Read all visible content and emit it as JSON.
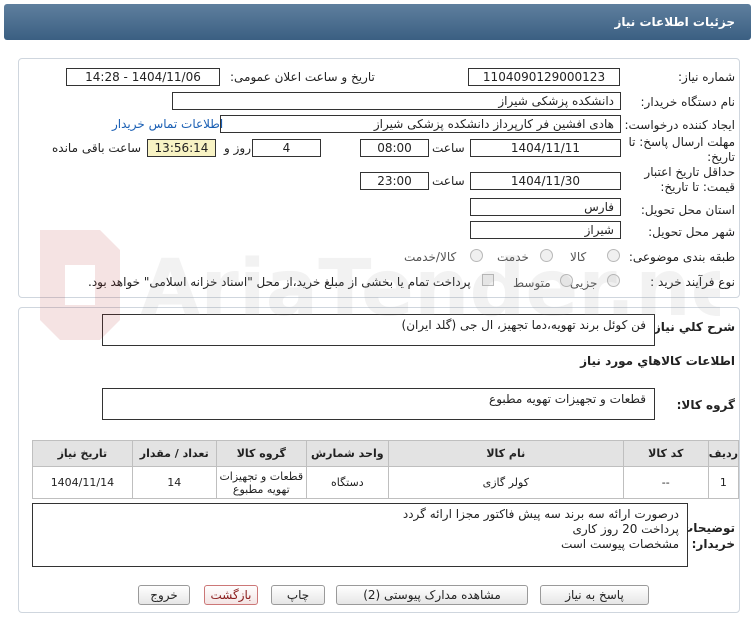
{
  "header": {
    "title": "جزئیات اطلاعات نیاز"
  },
  "form": {
    "need_number_label": "شماره نیاز:",
    "need_number": "1104090129000123",
    "announce_label": "تاریخ و ساعت اعلان عمومی:",
    "announce_value": "1404/11/06 - 14:28",
    "buyer_label": "نام دستگاه خریدار:",
    "buyer_value": "دانشکده پزشکی شیراز",
    "creator_label": "ایجاد کننده درخواست:",
    "creator_value": "هادی افشین فر کارپرداز دانشکده پزشکی شیراز",
    "contact_link": "اطلاعات تماس خریدار",
    "reply_deadline_label": "مهلت ارسال پاسخ: تا تاریخ:",
    "reply_date": "1404/11/11",
    "time_label": "ساعت",
    "reply_time": "08:00",
    "days_value": "4",
    "days_and_label": "روز و",
    "remaining_time": "13:56:14",
    "remaining_label": "ساعت باقی مانده",
    "validity_label": "حداقل تاریخ اعتبار قیمت: تا تاریخ:",
    "validity_date": "1404/11/30",
    "validity_time": "23:00",
    "province_label": "استان محل تحویل:",
    "province_value": "فارس",
    "city_label": "شهر محل تحویل:",
    "city_value": "شیراز",
    "category_label": "طبقه بندی موضوعی:",
    "category_options": [
      "کالا",
      "خدمت",
      "کالا/خدمت"
    ],
    "process_label": "نوع فرآیند خرید :",
    "process_options": [
      "جزیی",
      "متوسط"
    ],
    "process_note": "پرداخت تمام یا بخشی از مبلغ خرید،از محل \"اسناد خزانه اسلامی\" خواهد بود."
  },
  "summary": {
    "label": "شرح کلي نياز:",
    "value": "فن کوئل برند تهویه،دما تجهیز، ال جی (گلد ایران)"
  },
  "goods": {
    "section_title": "اطلاعات کالاهاي مورد نياز",
    "group_label": "گروه کالا:",
    "group_value": "قطعات و تجهیزات تهویه مطبوع"
  },
  "table": {
    "headers": [
      "رديف",
      "کد کالا",
      "نام کالا",
      "واحد شمارش",
      "گروه کالا",
      "تعداد / مقدار",
      "تاریخ نیاز"
    ],
    "rows": [
      [
        "1",
        "--",
        "کولر گازی",
        "دستگاه",
        "قطعات و تجهیزات تهویه مطبوع",
        "14",
        "1404/11/14"
      ]
    ]
  },
  "notes": {
    "label": "توضیحات خریدار:",
    "lines": [
      "درصورت ارائه سه  برند سه پیش فاکتور مجزا ارائه گردد",
      "پرداخت 20 روز کاری",
      "مشخصات پیوست است"
    ]
  },
  "buttons": {
    "reply": "پاسخ به نیاز",
    "attachments": "مشاهده مدارک پیوستی (2)",
    "print": "چاپ",
    "back": "بازگشت",
    "exit": "خروج"
  },
  "watermark": {
    "text": "AriaTender.neT"
  }
}
